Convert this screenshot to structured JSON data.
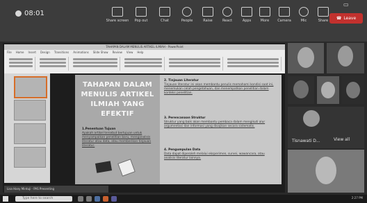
{
  "meeting_bar": {
    "timer": "08:01",
    "tools": [
      {
        "label": "Share screen",
        "name": "share-screen-button"
      },
      {
        "label": "Pop out",
        "name": "pop-out-button"
      },
      {
        "label": "Chat",
        "name": "chat-button"
      },
      {
        "label": "People",
        "name": "people-button"
      },
      {
        "label": "Raise",
        "name": "raise-hand-button"
      },
      {
        "label": "React",
        "name": "react-button"
      },
      {
        "label": "Apps",
        "name": "apps-button"
      },
      {
        "label": "More",
        "name": "more-button"
      },
      {
        "label": "Camera",
        "name": "camera-button"
      },
      {
        "label": "Mic",
        "name": "mic-button"
      },
      {
        "label": "Share",
        "name": "share-button"
      }
    ],
    "leave_label": "Leave"
  },
  "ppt": {
    "window_title": "TAHAPAN DALAM MENULIS ARTIKEL ILMIAH - PowerPoint",
    "tabs": [
      "File",
      "Home",
      "Insert",
      "Design",
      "Transitions",
      "Animations",
      "Slide Show",
      "Review",
      "View",
      "Help"
    ]
  },
  "slide": {
    "title_lines": [
      "TAHAPAN DALAM",
      "MENULIS ARTIKEL",
      "ILMIAH YANG EFEKTIF"
    ],
    "sections": [
      {
        "heading": "1.Penentuan Tujuan",
        "body": "Apakah artikel tersebut bertujuan untuk menyampaikan penelitian baru, menganalisis literatur atau data, atau memberikan tinjauan literatur."
      },
      {
        "heading": "2. Tinjauan Literatur",
        "body": "Tinjauan literatur ini akan membantu penulis memahami kondisi saat ini, menemukan celah pengetahuan, dan menempatkan penelitian dalam konteks penelitian."
      },
      {
        "heading": "3. Perencanaan Struktur",
        "body": "Struktur yang baik akan membantu pembaca dalam mengikuti alur argumentasi dan informasi yang disajikan secara sistematis."
      },
      {
        "heading": "4. Pengumpulan Data",
        "body": "Data dapat diperoleh melalui eksperimen, survei, wawancara, atau analisis literatur lainnya."
      }
    ]
  },
  "share_bar": {
    "presenter": "Lisa Hany Mintuji - PAS Presenting"
  },
  "participants": {
    "avatar_name": "Tisnawati D...",
    "view_all": "View all"
  },
  "taskbar": {
    "search_placeholder": "Type here to search",
    "clock": "2:27 PM"
  }
}
